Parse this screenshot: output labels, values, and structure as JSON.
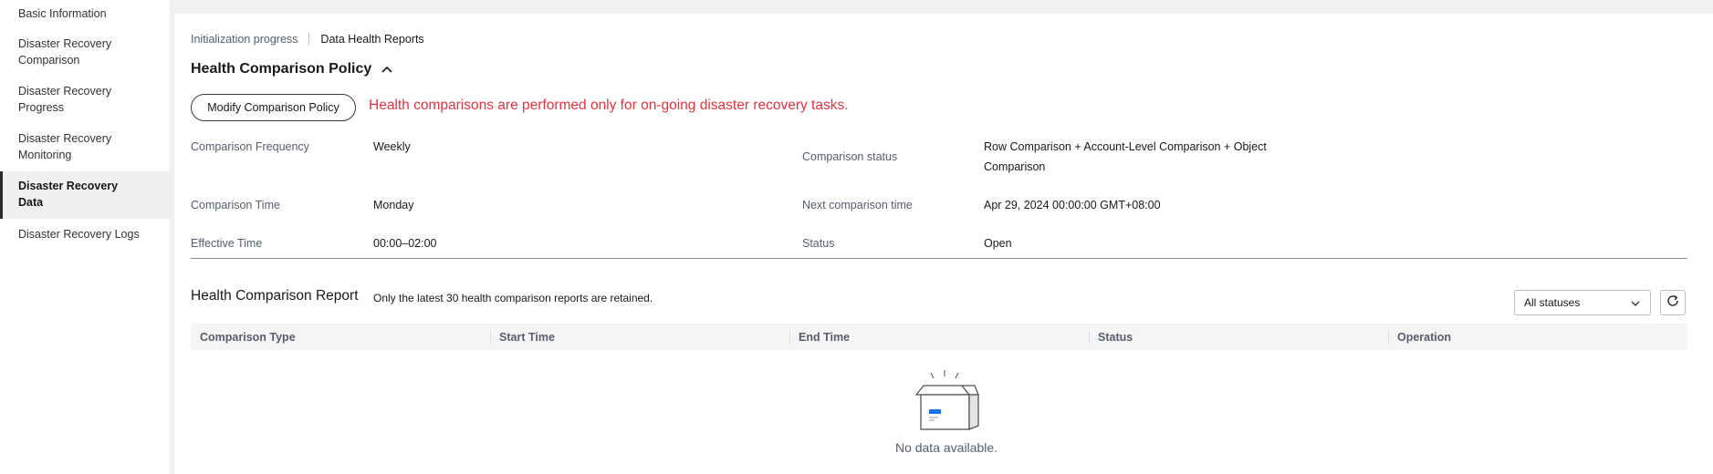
{
  "sidebar": {
    "items": [
      {
        "label": "Basic Information"
      },
      {
        "label": "Disaster Recovery Comparison"
      },
      {
        "label": "Disaster Recovery Progress"
      },
      {
        "label": "Disaster Recovery Monitoring"
      },
      {
        "label": "Disaster Recovery Data",
        "active": true
      },
      {
        "label": "Disaster Recovery Logs"
      }
    ]
  },
  "tabs": [
    {
      "label": "Initialization progress"
    },
    {
      "label": "Data Health Reports",
      "active": true
    }
  ],
  "policy": {
    "title": "Health Comparison Policy",
    "modify_button": "Modify Comparison Policy",
    "warning": "Health comparisons are performed only for on-going disaster recovery tasks.",
    "fields": {
      "frequency": {
        "label": "Comparison Frequency",
        "value": "Weekly"
      },
      "time": {
        "label": "Comparison Time",
        "value": "Monday"
      },
      "effective": {
        "label": "Effective Time",
        "value": "00:00–02:00"
      },
      "comp_status": {
        "label": "Comparison status",
        "value": "Row Comparison + Account-Level Comparison + Object Comparison"
      },
      "next_time": {
        "label": "Next comparison time",
        "value": "Apr 29, 2024 00:00:00 GMT+08:00"
      },
      "status": {
        "label": "Status",
        "value": "Open"
      }
    }
  },
  "report": {
    "title": "Health Comparison Report",
    "note": "Only the latest 30 health comparison reports are retained.",
    "status_filter": "All statuses",
    "columns": [
      "Comparison Type",
      "Start Time",
      "End Time",
      "Status",
      "Operation"
    ],
    "empty_text": "No data available."
  },
  "colors": {
    "warning": "#e6333f",
    "active_border": "#2b2b2b",
    "empty_icon_accent": "#1a73e8"
  },
  "icons": [
    "chevron-up-icon",
    "chevron-down-icon",
    "refresh-icon",
    "empty-box-icon"
  ]
}
